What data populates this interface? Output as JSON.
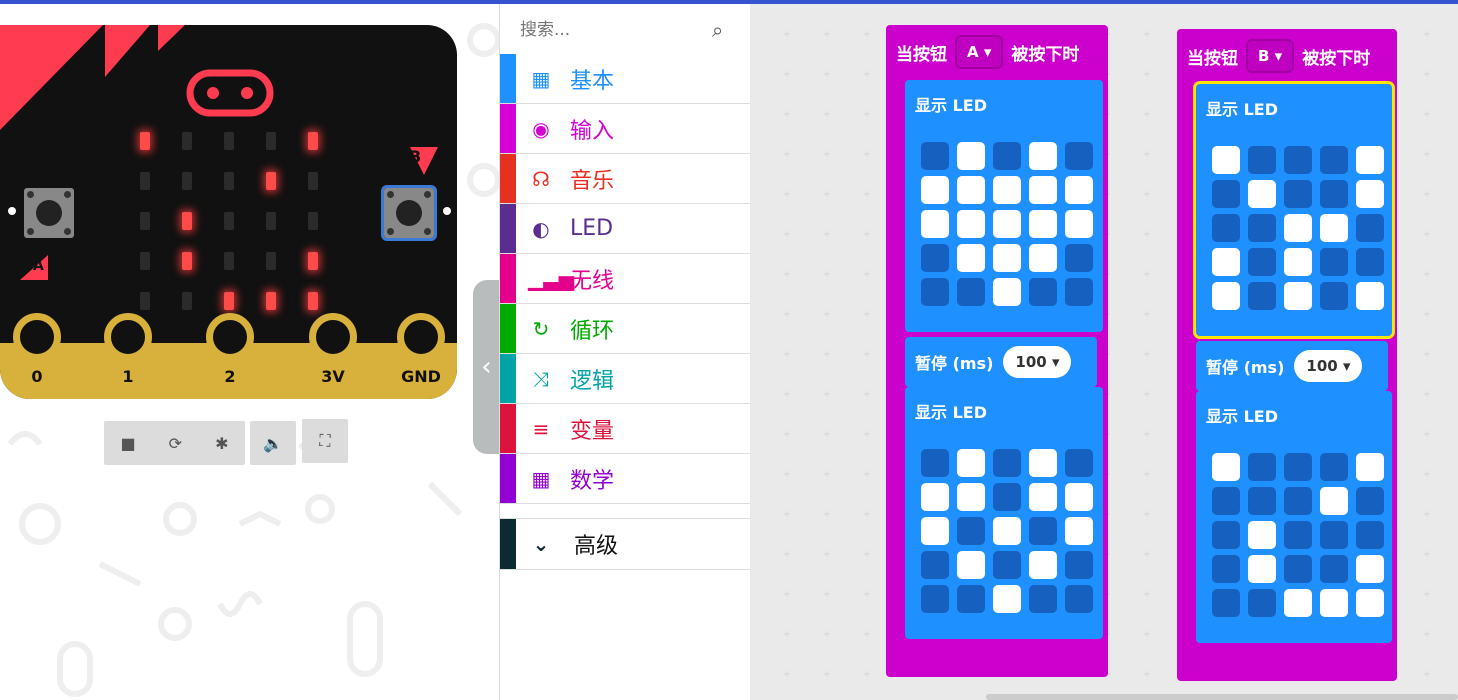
{
  "simulator": {
    "pin_labels": [
      "0",
      "1",
      "2",
      "3V",
      "GND"
    ],
    "button_a_label": "A",
    "button_b_label": "B",
    "leds": [
      [
        1,
        0,
        0,
        0,
        1
      ],
      [
        0,
        0,
        0,
        1,
        0
      ],
      [
        0,
        1,
        0,
        0,
        0
      ],
      [
        0,
        1,
        0,
        0,
        1
      ],
      [
        0,
        0,
        1,
        1,
        1
      ]
    ]
  },
  "toolbox": {
    "search_placeholder": "搜索...",
    "categories": [
      {
        "label": "基本",
        "color": "#1e90ff",
        "icon": "grid-icon"
      },
      {
        "label": "输入",
        "color": "#d400d4",
        "icon": "target-icon"
      },
      {
        "label": "音乐",
        "color": "#e63022",
        "icon": "headphones-icon"
      },
      {
        "label": "LED",
        "color": "#5c2d91",
        "icon": "toggle-icon"
      },
      {
        "label": "无线",
        "color": "#e3008c",
        "icon": "signal-icon"
      },
      {
        "label": "循环",
        "color": "#00aa00",
        "icon": "refresh-icon"
      },
      {
        "label": "逻辑",
        "color": "#00a4a6",
        "icon": "shuffle-icon"
      },
      {
        "label": "变量",
        "color": "#dc143c",
        "icon": "list-icon"
      },
      {
        "label": "数学",
        "color": "#9400d3",
        "icon": "calculator-icon"
      }
    ],
    "advanced_label": "高级",
    "advanced_color": "#0b2a32"
  },
  "workspace": {
    "event_a": {
      "prefix": "当按钮",
      "button": "A",
      "suffix": "被按下时",
      "show1_title": "显示 LED",
      "grid1": [
        [
          0,
          1,
          0,
          1,
          0
        ],
        [
          1,
          1,
          1,
          1,
          1
        ],
        [
          1,
          1,
          1,
          1,
          1
        ],
        [
          0,
          1,
          1,
          1,
          0
        ],
        [
          0,
          0,
          1,
          0,
          0
        ]
      ],
      "pause_label": "暂停 (ms)",
      "pause_value": "100",
      "show2_title": "显示 LED",
      "grid2": [
        [
          0,
          1,
          0,
          1,
          0
        ],
        [
          1,
          1,
          0,
          1,
          1
        ],
        [
          1,
          0,
          1,
          0,
          1
        ],
        [
          0,
          1,
          0,
          1,
          0
        ],
        [
          0,
          0,
          1,
          0,
          0
        ]
      ]
    },
    "event_b": {
      "prefix": "当按钮",
      "button": "B",
      "suffix": "被按下时",
      "show1_title": "显示 LED",
      "grid1": [
        [
          1,
          0,
          0,
          0,
          1
        ],
        [
          0,
          1,
          0,
          0,
          1
        ],
        [
          0,
          0,
          1,
          1,
          0
        ],
        [
          1,
          0,
          1,
          0,
          0
        ],
        [
          1,
          0,
          1,
          0,
          1
        ]
      ],
      "pause_label": "暂停 (ms)",
      "pause_value": "100",
      "show2_title": "显示 LED",
      "grid2": [
        [
          1,
          0,
          0,
          0,
          1
        ],
        [
          0,
          0,
          0,
          1,
          0
        ],
        [
          0,
          1,
          0,
          0,
          0
        ],
        [
          0,
          1,
          0,
          0,
          1
        ],
        [
          0,
          0,
          1,
          1,
          1
        ]
      ]
    }
  }
}
